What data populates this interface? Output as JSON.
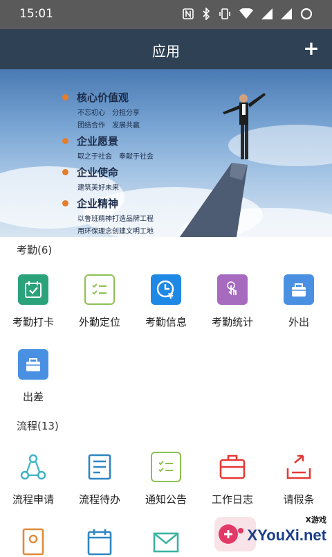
{
  "status_bar": {
    "time": "15:01"
  },
  "app_bar": {
    "title": "应用",
    "add_label": "+"
  },
  "banner": {
    "values": [
      {
        "heading": "核心价值观",
        "lines": [
          "不忘初心　分担分享",
          "团结合作　发展共赢"
        ]
      },
      {
        "heading": "企业愿景",
        "lines": [
          "取之于社会　奉献于社会"
        ]
      },
      {
        "heading": "企业使命",
        "lines": [
          "建筑美好未来"
        ]
      },
      {
        "heading": "企业精神",
        "lines": [
          "以鲁班精神打造品牌工程",
          "用环保理念创建文明工地"
        ]
      }
    ]
  },
  "sections": {
    "attendance": {
      "title": "考勤(6)",
      "items": [
        {
          "label": "考勤打卡",
          "icon": "calendar-check-icon",
          "color": "#2aa37a"
        },
        {
          "label": "外勤定位",
          "icon": "checklist-icon",
          "color": "#8cc152"
        },
        {
          "label": "考勤信息",
          "icon": "clock-yen-icon",
          "color": "#1e88e5"
        },
        {
          "label": "考勤统计",
          "icon": "tap-hand-icon",
          "color": "#a66bbe"
        },
        {
          "label": "外出",
          "icon": "bag-icon",
          "color": "#4a90e2"
        },
        {
          "label": "出差",
          "icon": "suitcase-icon",
          "color": "#4a90e2"
        }
      ]
    },
    "process": {
      "title": "流程(13)",
      "items": [
        {
          "label": "流程申请",
          "icon": "share-nodes-icon",
          "color": "#3bb3c3"
        },
        {
          "label": "流程待办",
          "icon": "document-list-icon",
          "color": "#2e86c1"
        },
        {
          "label": "通知公告",
          "icon": "checklist-icon",
          "color": "#8cc152"
        },
        {
          "label": "工作日志",
          "icon": "briefcase-icon",
          "color": "#e53935"
        },
        {
          "label": "请假条",
          "icon": "outbox-icon",
          "color": "#e53935"
        }
      ]
    },
    "more_row": {
      "icons": [
        "contact-card-icon",
        "calendar-icon",
        "mail-icon"
      ]
    }
  },
  "watermark": {
    "brand": "XYouXi.net",
    "tag": "X游戏"
  }
}
